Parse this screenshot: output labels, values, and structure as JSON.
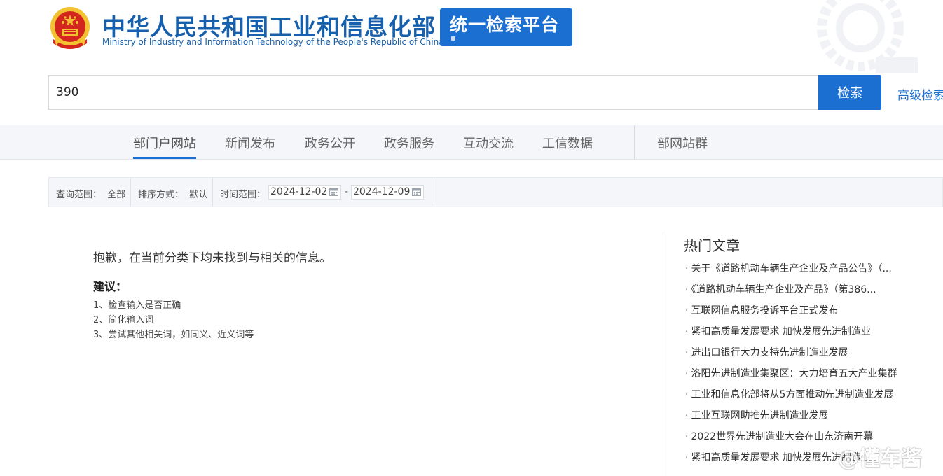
{
  "header": {
    "site_name_cn": "中华人民共和国工业和信息化部",
    "site_name_en": "Ministry of Industry and Information Technology of the People's Republic of China",
    "platform_label": "统一检索平台"
  },
  "search": {
    "query": "390",
    "button_label": "检索",
    "advanced_label": "高级检索"
  },
  "nav": {
    "tabs": [
      "部门户网站",
      "新闻发布",
      "政务公开",
      "政务服务",
      "互动交流",
      "工信数据"
    ],
    "active_tab": "部门户网站",
    "extra_tab": "部网站群"
  },
  "filters": {
    "scope_label": "查询范围：",
    "scope_value": "全部",
    "sort_label": "排序方式：",
    "sort_value": "默认",
    "time_label": "时间范围：",
    "date_from": "2024-12-02",
    "date_separator": "-",
    "date_to": "2024-12-09"
  },
  "results": {
    "no_result_message": "抱歉，在当前分类下均未找到与相关的信息。",
    "suggestion_title": "建议：",
    "suggestions": [
      "1、检查输入是否正确",
      "2、简化输入词",
      "3、尝试其他相关词，如同义、近义词等"
    ]
  },
  "hot_articles": {
    "title": "热门文章",
    "bullet": "·",
    "items": [
      "关于《道路机动车辆生产企业及产品公告》（...",
      "《道路机动车辆生产企业及产品》（第386...",
      "互联网信息服务投诉平台正式发布",
      "紧扣高质量发展要求 加快发展先进制造业",
      "进出口银行大力支持先进制造业发展",
      "洛阳先进制造业集聚区：大力培育五大产业集群",
      "工业和信息化部将从5方面推动先进制造业发展",
      "工业互联网助推先进制造业发展",
      "2022世界先进制造业大会在山东济南开幕",
      "紧扣高质量发展要求 加快发展先进制造业"
    ]
  },
  "watermark": {
    "text": "@懂车酱"
  },
  "icons": {
    "emblem": "national-emblem-icon",
    "calendar": "calendar-icon",
    "logo_mark": "miit-logo-icon"
  },
  "colors": {
    "brand_blue": "#1760ad",
    "button_blue": "#1b6fd1",
    "nav_bg": "#f4f6f9",
    "emblem_red": "#d3261e",
    "emblem_gold": "#f2c230"
  }
}
